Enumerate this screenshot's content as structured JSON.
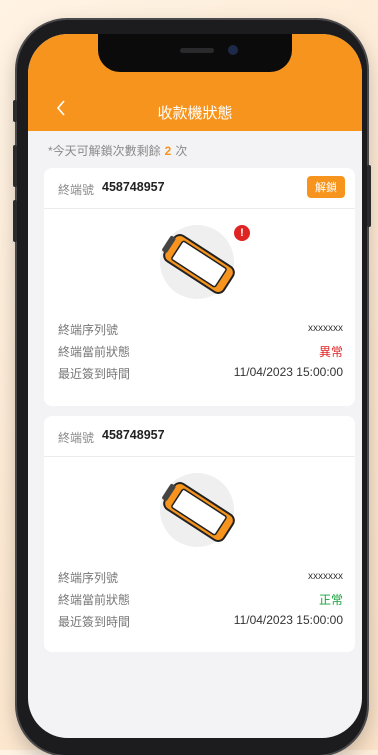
{
  "header": {
    "title": "收款機狀態",
    "back_icon": "chevron-left-icon"
  },
  "unlock_info": {
    "prefix": "*今天可解鎖次數剩餘",
    "count": "2",
    "suffix": "次"
  },
  "labels": {
    "terminal_no": "終端號",
    "serial": "終端序列號",
    "status": "終端當前狀態",
    "last_checkin": "最近簽到時間"
  },
  "terminals": [
    {
      "terminal_no": "458748957",
      "unlock_label": "解鎖",
      "serial": "xxxxxxx",
      "status": "異常",
      "status_color": "#e02424",
      "alert_icon": "!",
      "last_checkin": "11/04/2023 15:00:00"
    },
    {
      "terminal_no": "458748957",
      "serial": "xxxxxxx",
      "status": "正常",
      "status_color": "#1aa33b",
      "last_checkin": "11/04/2023 15:00:00"
    }
  ],
  "colors": {
    "accent": "#f7941d",
    "background": "#f3f3f5"
  }
}
